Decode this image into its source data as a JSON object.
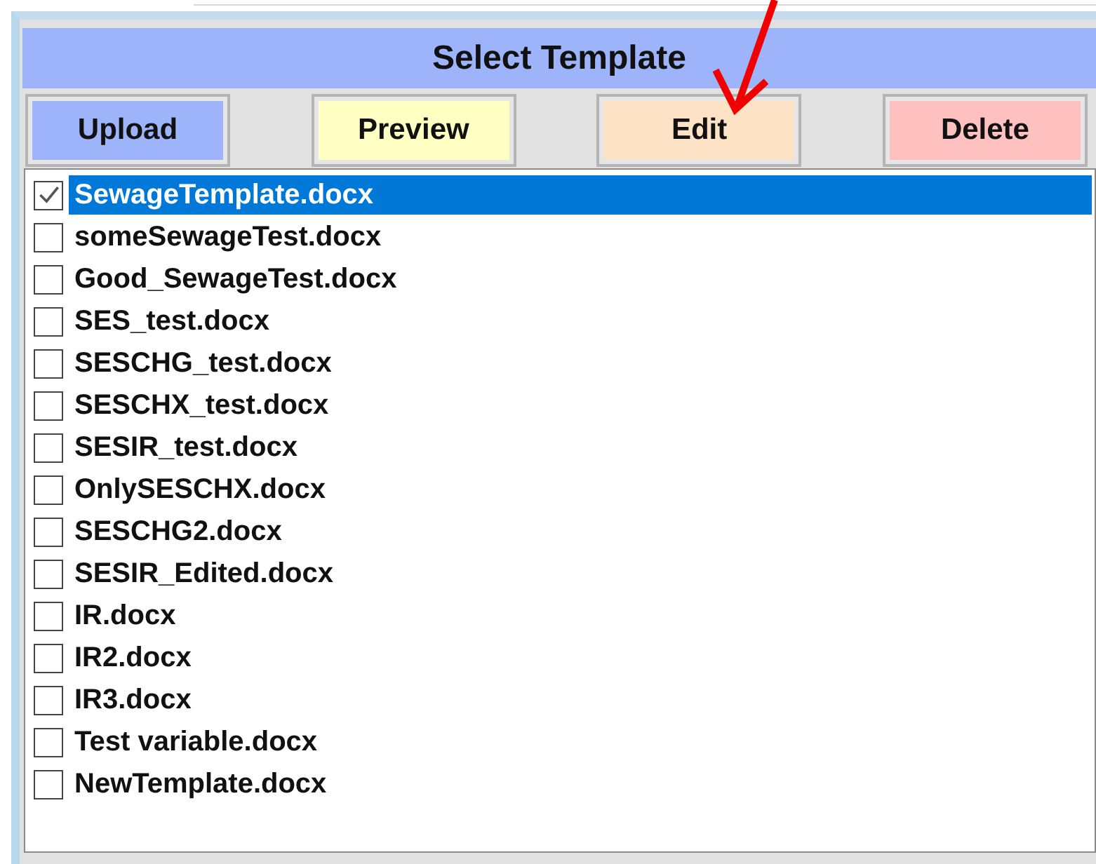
{
  "panel": {
    "title": "Select Template"
  },
  "buttons": [
    {
      "label": "Upload",
      "color": "#9db4fa"
    },
    {
      "label": "Preview",
      "color": "#ffffc4"
    },
    {
      "label": "Edit",
      "color": "#fde2c6"
    },
    {
      "label": "Delete",
      "color": "#ffc0c0"
    }
  ],
  "templates": [
    {
      "name": "SewageTemplate.docx",
      "checked": true,
      "selected": true
    },
    {
      "name": "someSewageTest.docx",
      "checked": false,
      "selected": false
    },
    {
      "name": "Good_SewageTest.docx",
      "checked": false,
      "selected": false
    },
    {
      "name": "SES_test.docx",
      "checked": false,
      "selected": false
    },
    {
      "name": "SESCHG_test.docx",
      "checked": false,
      "selected": false
    },
    {
      "name": "SESCHX_test.docx",
      "checked": false,
      "selected": false
    },
    {
      "name": "SESIR_test.docx",
      "checked": false,
      "selected": false
    },
    {
      "name": "OnlySESCHX.docx",
      "checked": false,
      "selected": false
    },
    {
      "name": "SESCHG2.docx",
      "checked": false,
      "selected": false
    },
    {
      "name": "SESIR_Edited.docx",
      "checked": false,
      "selected": false
    },
    {
      "name": "IR.docx",
      "checked": false,
      "selected": false
    },
    {
      "name": "IR2.docx",
      "checked": false,
      "selected": false
    },
    {
      "name": "IR3.docx",
      "checked": false,
      "selected": false
    },
    {
      "name": "Test variable.docx",
      "checked": false,
      "selected": false
    },
    {
      "name": "NewTemplate.docx",
      "checked": false,
      "selected": false
    }
  ]
}
